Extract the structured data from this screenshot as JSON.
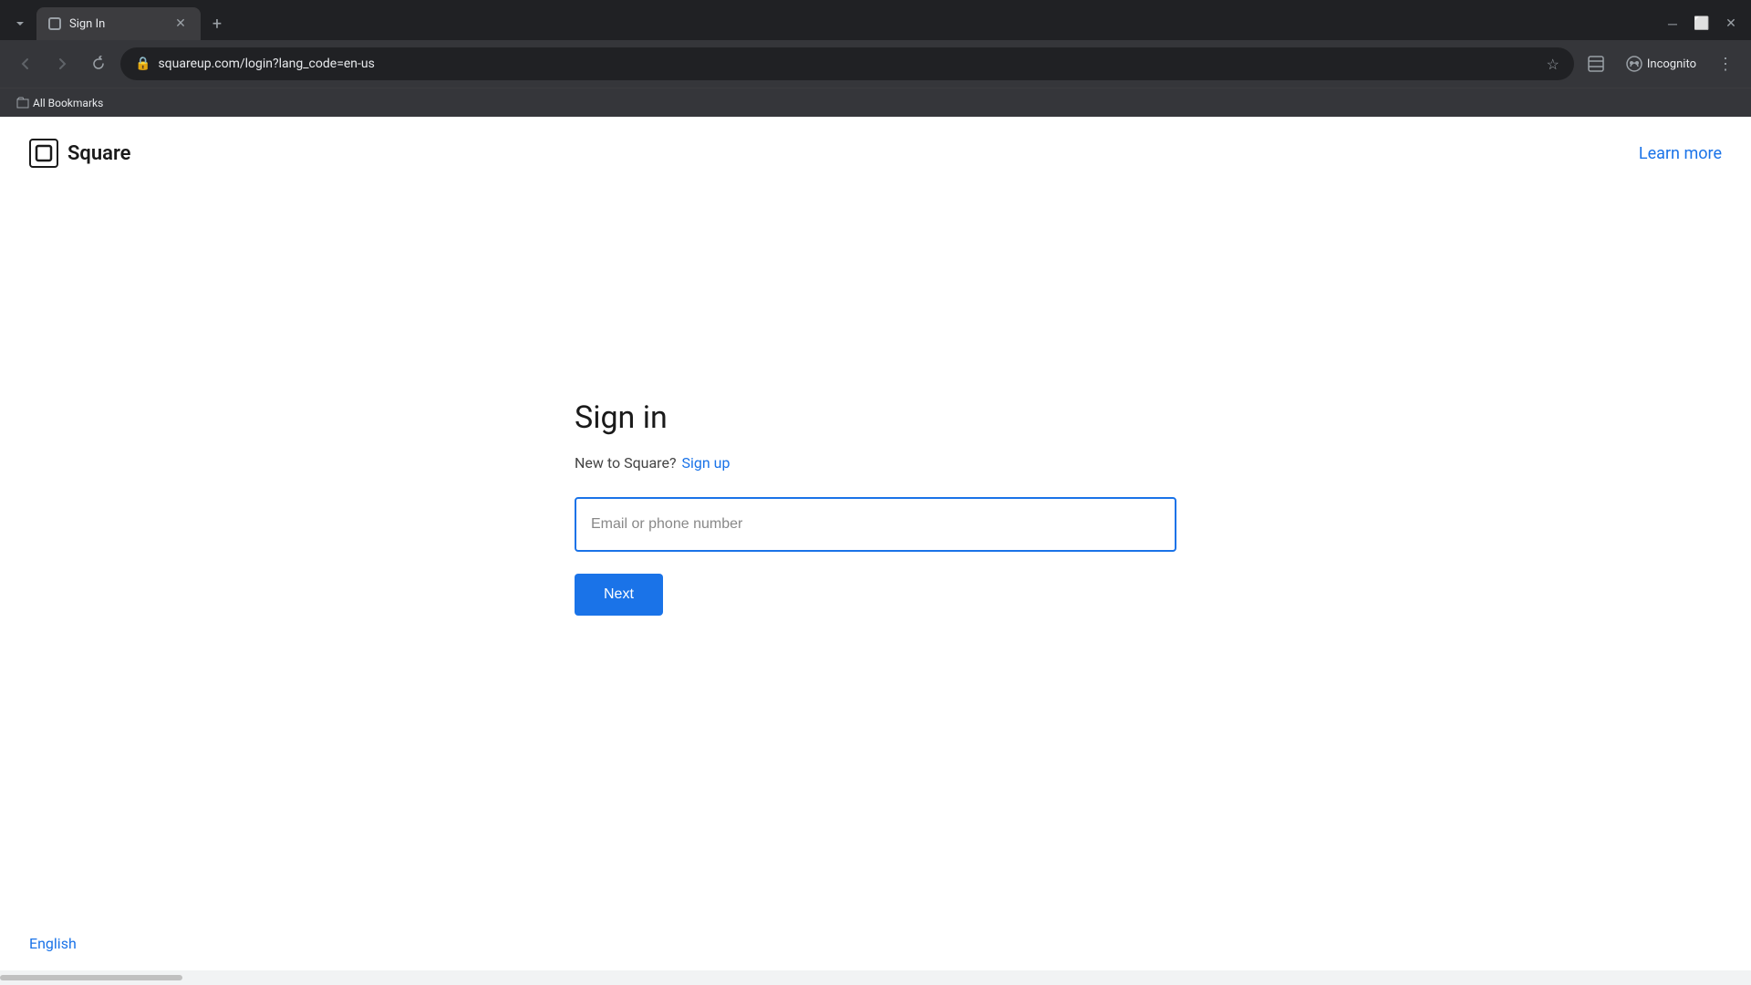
{
  "browser": {
    "tab": {
      "title": "Sign In",
      "favicon": "🔲"
    },
    "address": "squareup.com/login?lang_code=en-us",
    "new_tab_label": "+",
    "incognito_label": "Incognito",
    "bookmarks_label": "All Bookmarks"
  },
  "header": {
    "logo_text": "Square",
    "logo_icon": "□",
    "learn_more_label": "Learn more"
  },
  "form": {
    "title": "Sign in",
    "new_account_text": "New to Square?",
    "sign_up_label": "Sign up",
    "input_placeholder": "Email or phone number",
    "next_button_label": "Next"
  },
  "footer": {
    "language_label": "English"
  }
}
